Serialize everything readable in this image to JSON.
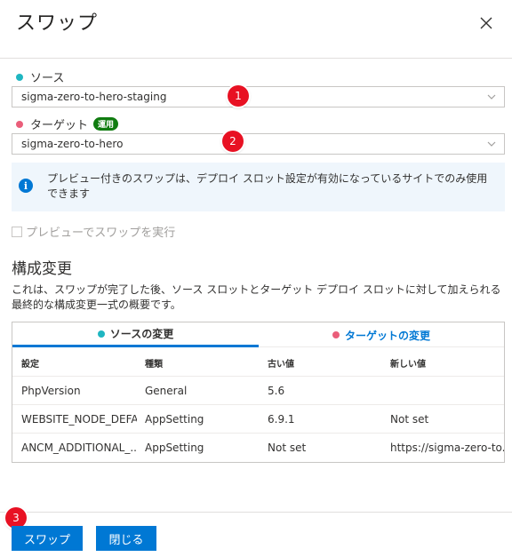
{
  "dialog": {
    "title": "スワップ"
  },
  "source": {
    "label": "ソース",
    "value": "sigma-zero-to-hero-staging",
    "step": "1"
  },
  "target": {
    "label": "ターゲット",
    "badge": "運用",
    "value": "sigma-zero-to-hero",
    "step": "2"
  },
  "info": {
    "text": "プレビュー付きのスワップは、デプロイ スロット設定が有効になっているサイトでのみ使用できます"
  },
  "preview_checkbox": {
    "label": "プレビューでスワップを実行",
    "checked": false
  },
  "config": {
    "title": "構成変更",
    "description": "これは、スワップが完了した後、ソース スロットとターゲット デプロイ スロットに対して加えられる最終的な構成変更一式の概要です。",
    "tabs": {
      "source": "ソースの変更",
      "target": "ターゲットの変更"
    },
    "columns": [
      "設定",
      "種類",
      "古い値",
      "新しい値"
    ],
    "rows": [
      [
        "PhpVersion",
        "General",
        "5.6",
        ""
      ],
      [
        "WEBSITE_NODE_DEFA...",
        "AppSetting",
        "6.9.1",
        "Not set"
      ],
      [
        "ANCM_ADDITIONAL_...",
        "AppSetting",
        "Not set",
        "https://sigma-zero-to..."
      ]
    ]
  },
  "footer": {
    "swap_label": "スワップ",
    "close_label": "閉じる",
    "step": "3"
  },
  "colors": {
    "accent": "#0078d4",
    "source_dot": "#1fb6c1",
    "target_dot": "#ea5e7a",
    "badge": "#107c10",
    "step_badge": "#e81123"
  }
}
